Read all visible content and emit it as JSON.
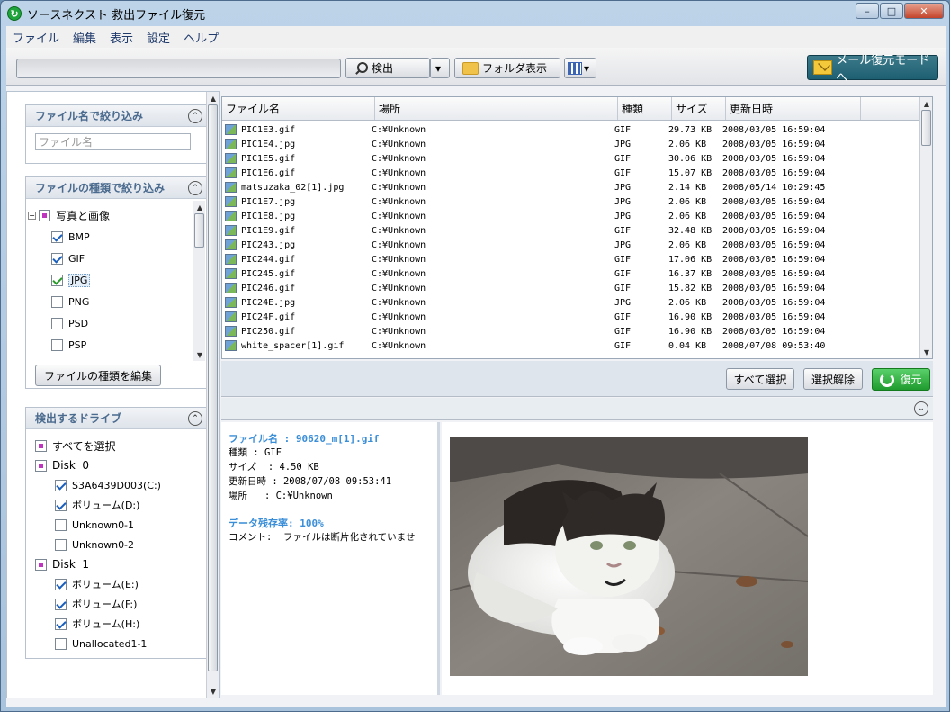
{
  "window": {
    "title": "ソースネクスト 救出ファイル復元",
    "app_icon_glyph": "↻",
    "controls": {
      "minimize": "–",
      "maximize": "□",
      "close": "✕"
    }
  },
  "menu": [
    "ファイル",
    "編集",
    "表示",
    "設定",
    "ヘルプ"
  ],
  "toolbar": {
    "search_value": "",
    "detect_label": "検出",
    "dropdown_glyph": "▾",
    "folder_view_label": "フォルダ表示",
    "view_dropdown_glyph": "▾",
    "mail_mode_label": "メール復元モードへ"
  },
  "sidebar": {
    "name_filter": {
      "title": "ファイル名で絞り込み",
      "placeholder": "ファイル名"
    },
    "type_filter": {
      "title": "ファイルの種類で絞り込み",
      "group_label": "写真と画像",
      "items": [
        {
          "label": "BMP",
          "checked": true
        },
        {
          "label": "GIF",
          "checked": true
        },
        {
          "label": "JPG",
          "checked": true
        },
        {
          "label": "PNG",
          "checked": false
        },
        {
          "label": "PSD",
          "checked": false
        },
        {
          "label": "PSP",
          "checked": false
        }
      ],
      "edit_button": "ファイルの種類を編集"
    },
    "drives": {
      "title": "検出するドライブ",
      "select_all": "すべてを選択",
      "disk0": "Disk  0",
      "disk1": "Disk  1",
      "disk0_items": [
        {
          "label": "S3A6439D003(C:)",
          "checked": true
        },
        {
          "label": "ボリューム(D:)",
          "checked": true
        },
        {
          "label": "Unknown0-1",
          "checked": false
        },
        {
          "label": "Unknown0-2",
          "checked": false
        }
      ],
      "disk1_items": [
        {
          "label": "ボリューム(E:)",
          "checked": true
        },
        {
          "label": "ボリューム(F:)",
          "checked": true
        },
        {
          "label": "ボリューム(H:)",
          "checked": true
        },
        {
          "label": "Unallocated1-1",
          "checked": false
        }
      ]
    }
  },
  "file_list": {
    "columns": [
      "ファイル名",
      "場所",
      "種類",
      "サイズ",
      "更新日時"
    ],
    "rows": [
      [
        "PIC1E3.gif",
        "C:¥Unknown",
        "GIF",
        "29.73 KB",
        "2008/03/05 16:59:04"
      ],
      [
        "PIC1E4.jpg",
        "C:¥Unknown",
        "JPG",
        "2.06 KB",
        "2008/03/05 16:59:04"
      ],
      [
        "PIC1E5.gif",
        "C:¥Unknown",
        "GIF",
        "30.06 KB",
        "2008/03/05 16:59:04"
      ],
      [
        "PIC1E6.gif",
        "C:¥Unknown",
        "GIF",
        "15.07 KB",
        "2008/03/05 16:59:04"
      ],
      [
        "matsuzaka_02[1].jpg",
        "C:¥Unknown",
        "JPG",
        "2.14 KB",
        "2008/05/14 10:29:45"
      ],
      [
        "PIC1E7.jpg",
        "C:¥Unknown",
        "JPG",
        "2.06 KB",
        "2008/03/05 16:59:04"
      ],
      [
        "PIC1E8.jpg",
        "C:¥Unknown",
        "JPG",
        "2.06 KB",
        "2008/03/05 16:59:04"
      ],
      [
        "PIC1E9.gif",
        "C:¥Unknown",
        "GIF",
        "32.48 KB",
        "2008/03/05 16:59:04"
      ],
      [
        "PIC243.jpg",
        "C:¥Unknown",
        "JPG",
        "2.06 KB",
        "2008/03/05 16:59:04"
      ],
      [
        "PIC244.gif",
        "C:¥Unknown",
        "GIF",
        "17.06 KB",
        "2008/03/05 16:59:04"
      ],
      [
        "PIC245.gif",
        "C:¥Unknown",
        "GIF",
        "16.37 KB",
        "2008/03/05 16:59:04"
      ],
      [
        "PIC246.gif",
        "C:¥Unknown",
        "GIF",
        "15.82 KB",
        "2008/03/05 16:59:04"
      ],
      [
        "PIC24E.jpg",
        "C:¥Unknown",
        "JPG",
        "2.06 KB",
        "2008/03/05 16:59:04"
      ],
      [
        "PIC24F.gif",
        "C:¥Unknown",
        "GIF",
        "16.90 KB",
        "2008/03/05 16:59:04"
      ],
      [
        "PIC250.gif",
        "C:¥Unknown",
        "GIF",
        "16.90 KB",
        "2008/03/05 16:59:04"
      ],
      [
        "white_spacer[1].gif",
        "C:¥Unknown",
        "GIF",
        "0.04 KB",
        "2008/07/08 09:53:40"
      ]
    ]
  },
  "actions": {
    "select_all": "すべて選択",
    "deselect": "選択解除",
    "restore": "復元"
  },
  "details": {
    "filename_line": "ファイル名 : 90620_m[1].gif",
    "type_line": "種類 : GIF",
    "size_line": "サイズ  : 4.50 KB",
    "updated_line": "更新日時 : 2008/07/08 09:53:41",
    "location_line": "場所   : C:¥Unknown",
    "residual_line": "データ残存率: 100%",
    "comment_line": "コメント:  ファイルは断片化されていませ"
  },
  "icons": {
    "collapse": "collapse-up-icon",
    "expand": "expand-down-icon",
    "scroll_up": "▲",
    "scroll_down": "▼",
    "tree_minus": "−",
    "collapse_glyph": "⌃",
    "expand_glyph": "⌄"
  },
  "colors": {
    "accent": "#1f9b2e",
    "link": "#3a8ed8",
    "mail_btn": "#1e5f72"
  }
}
